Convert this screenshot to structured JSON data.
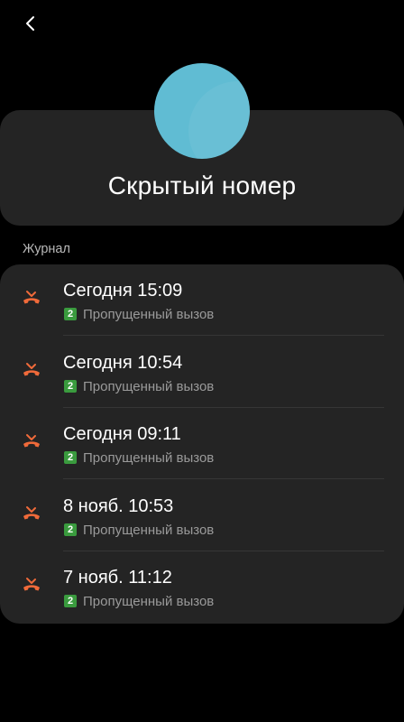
{
  "contact": {
    "name": "Скрытый номер",
    "avatar_color": "#60bcd3"
  },
  "log": {
    "section_label": "Журнал",
    "missed_icon_color": "#f06a3a",
    "sim_badge_color": "#3a9b3e",
    "entries": [
      {
        "time": "Сегодня 15:09",
        "sim": "2",
        "status": "Пропущенный вызов",
        "icon": "missed-call-icon"
      },
      {
        "time": "Сегодня 10:54",
        "sim": "2",
        "status": "Пропущенный вызов",
        "icon": "missed-call-icon"
      },
      {
        "time": "Сегодня 09:11",
        "sim": "2",
        "status": "Пропущенный вызов",
        "icon": "missed-call-icon"
      },
      {
        "time": "8 нояб. 10:53",
        "sim": "2",
        "status": "Пропущенный вызов",
        "icon": "missed-call-icon"
      },
      {
        "time": "7 нояб. 11:12",
        "sim": "2",
        "status": "Пропущенный вызов",
        "icon": "missed-call-icon"
      }
    ]
  },
  "nav": {
    "back_icon": "chevron-left-icon"
  }
}
